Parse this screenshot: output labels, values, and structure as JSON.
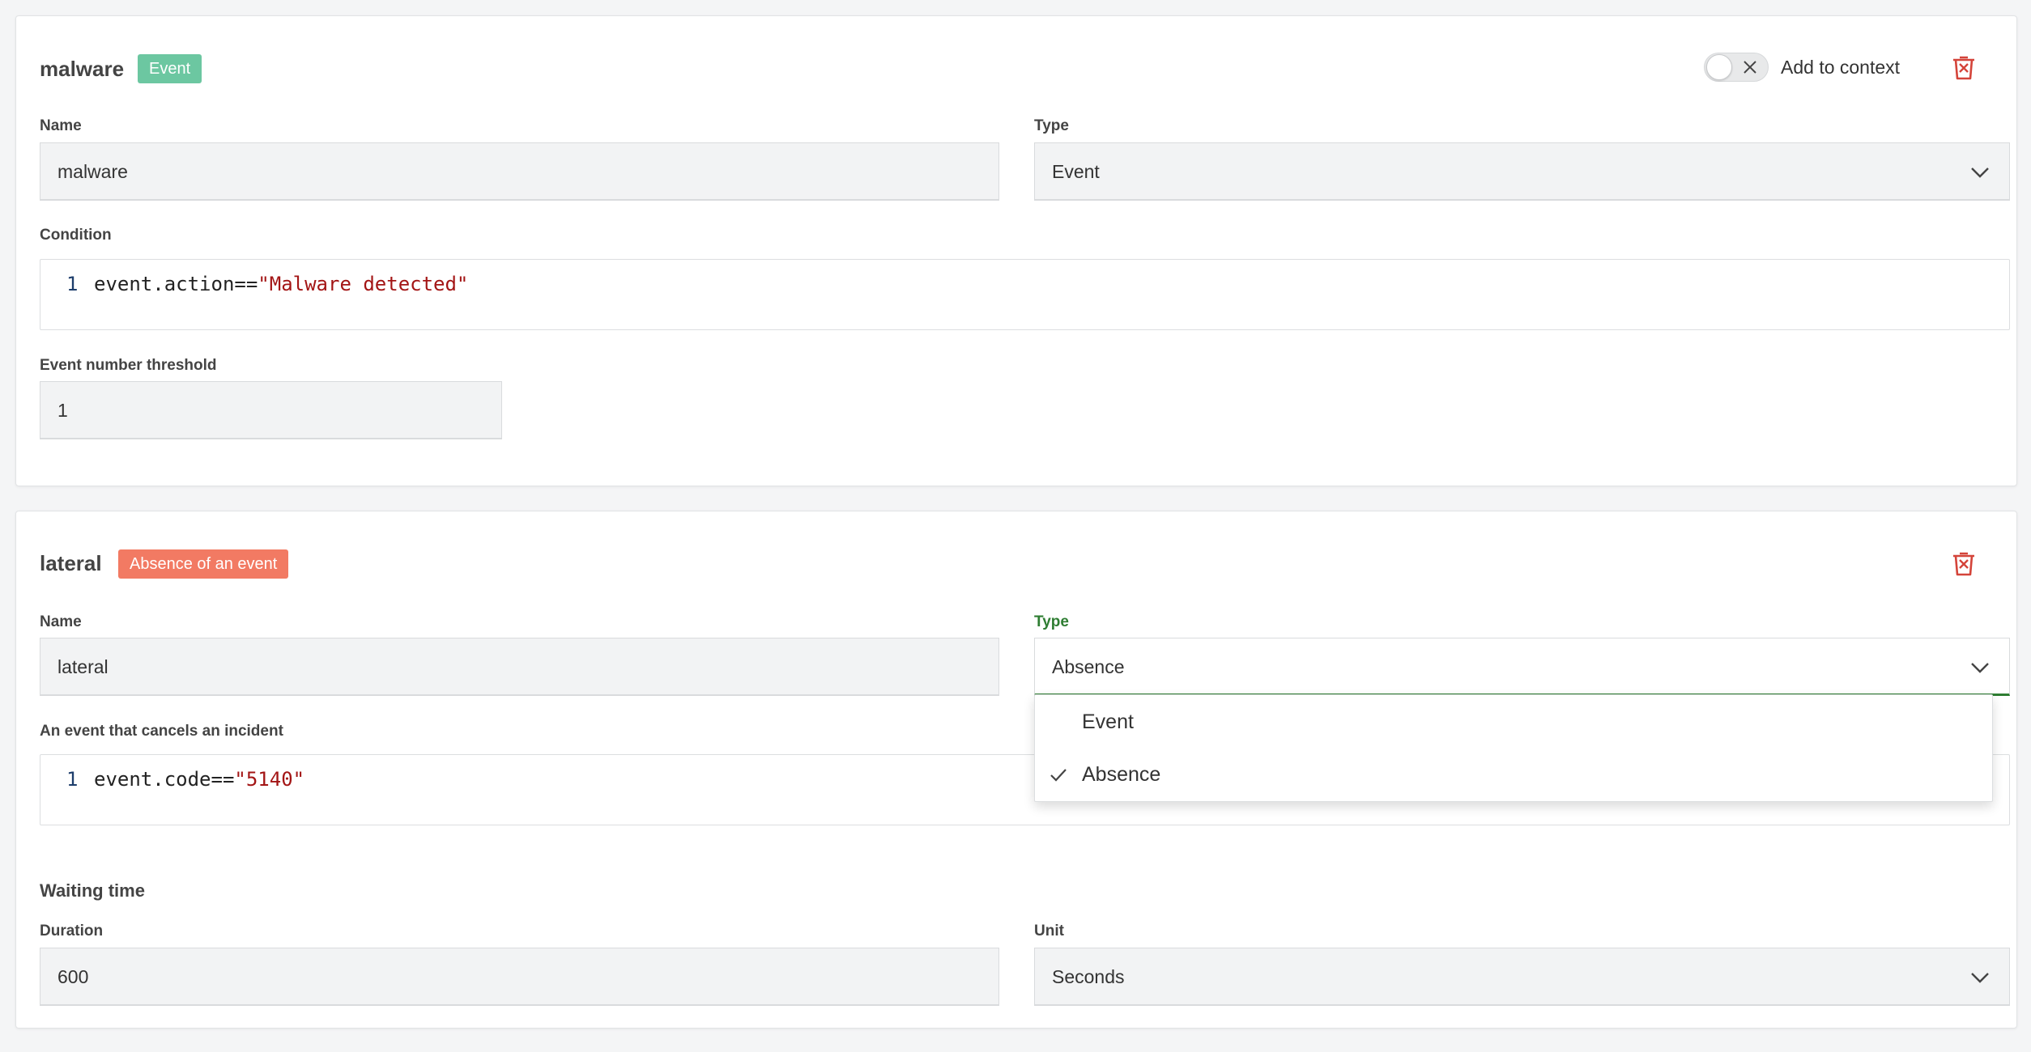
{
  "colors": {
    "event_badge": "#6cc7a1",
    "absence_badge": "#f27a63",
    "delete_icon": "#d4443a",
    "active_label": "#2e7d32",
    "active_underline": "#2e7d32"
  },
  "card1": {
    "title": "malware",
    "badge": "Event",
    "context_label": "Add to context",
    "name_label": "Name",
    "name_value": "malware",
    "type_label": "Type",
    "type_value": "Event",
    "condition_label": "Condition",
    "condition_line": "1",
    "condition_code_prefix": "event.action==",
    "condition_code_string": "\"Malware detected\"",
    "threshold_label": "Event number threshold",
    "threshold_value": "1"
  },
  "card2": {
    "title": "lateral",
    "badge": "Absence of an event",
    "name_label": "Name",
    "name_value": "lateral",
    "type_label": "Type",
    "type_value": "Absence",
    "cancel_label": "An event that cancels an incident",
    "cancel_line": "1",
    "cancel_code_prefix": "event.code==",
    "cancel_code_string": "\"5140\"",
    "waiting_label": "Waiting time",
    "duration_label": "Duration",
    "duration_value": "600",
    "unit_label": "Unit",
    "unit_value": "Seconds"
  },
  "type_dropdown": {
    "options": [
      "Event",
      "Absence"
    ],
    "selected": "Absence"
  }
}
